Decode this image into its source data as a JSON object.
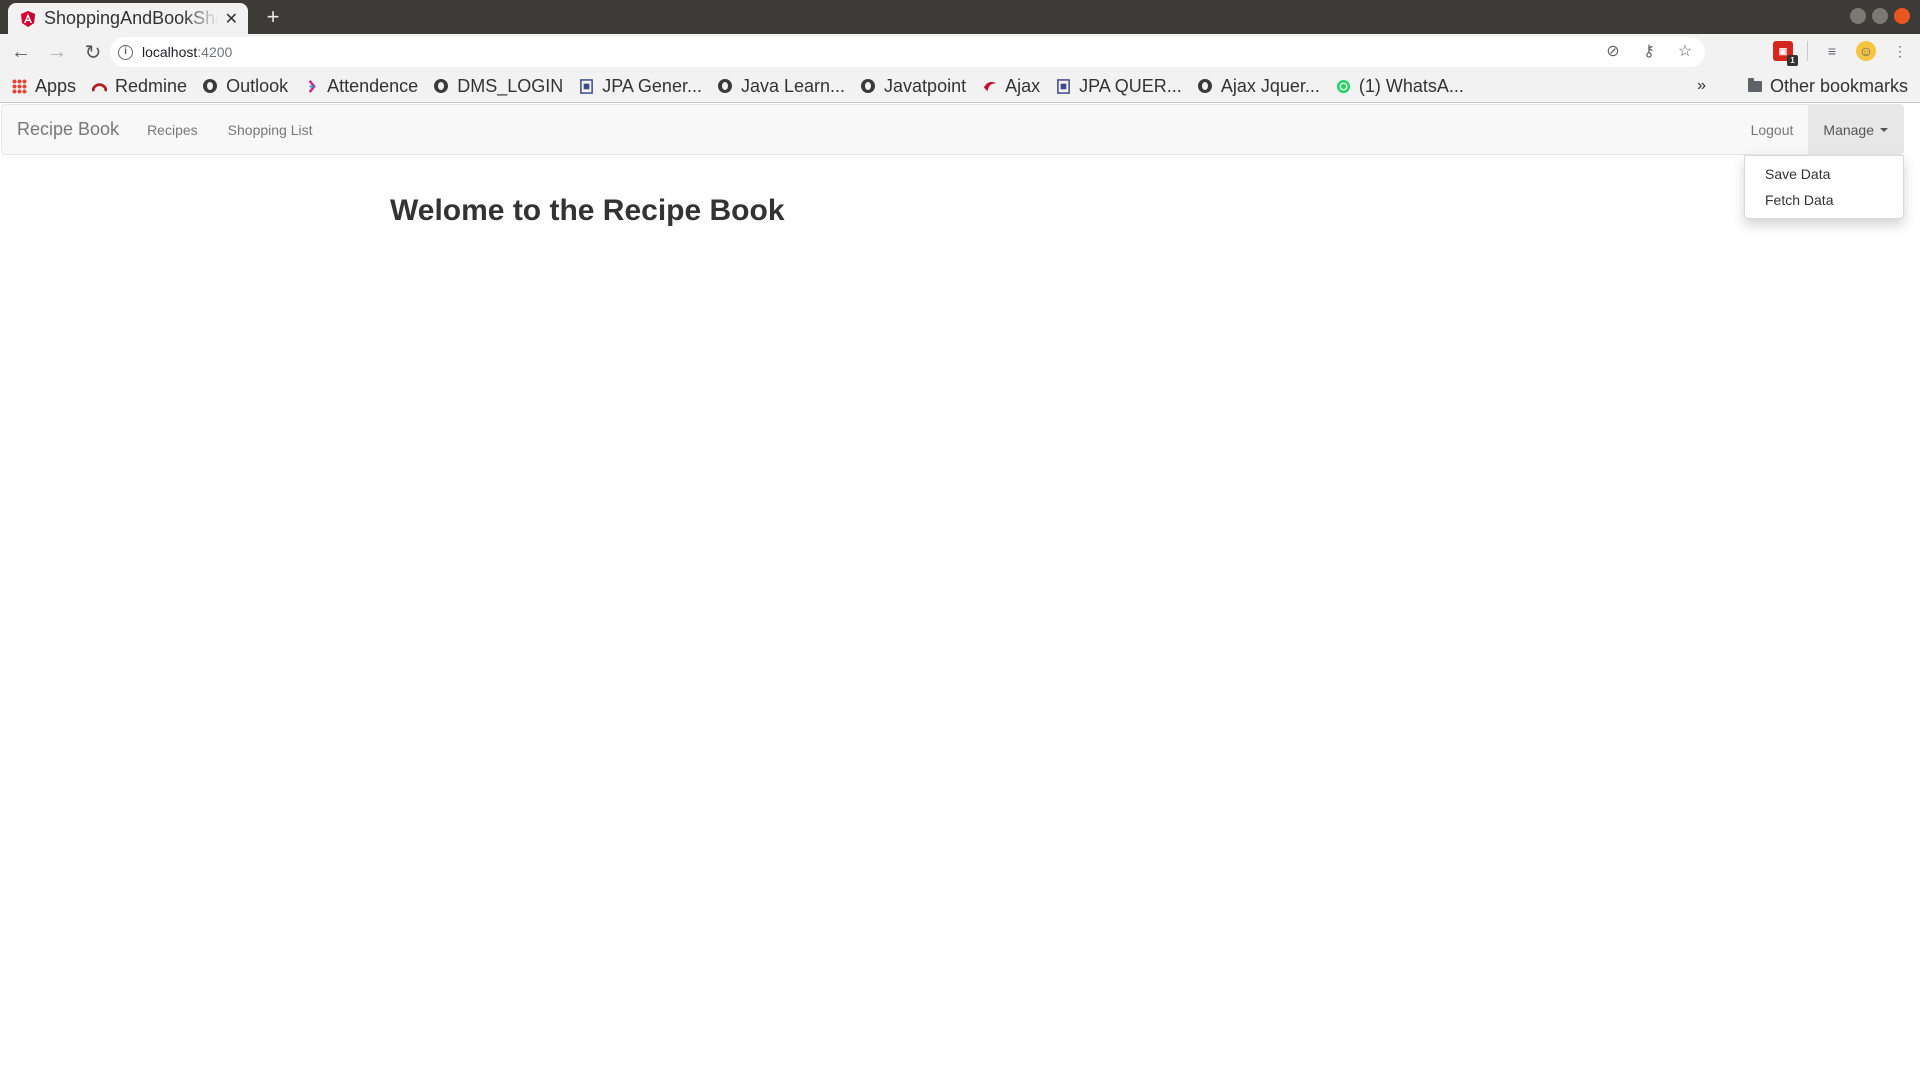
{
  "browser": {
    "tab_title": "ShoppingAndBookShop",
    "url_host": "localhost",
    "url_port": ":4200",
    "bookmarks": [
      {
        "label": "Apps",
        "icon": "apps-grid-icon"
      },
      {
        "label": "Redmine",
        "icon": "redmine-icon"
      },
      {
        "label": "Outlook",
        "icon": "globe-icon"
      },
      {
        "label": "Attendence",
        "icon": "attendence-icon"
      },
      {
        "label": "DMS_LOGIN",
        "icon": "globe-icon"
      },
      {
        "label": "JPA Gener...",
        "icon": "document-icon"
      },
      {
        "label": "Java Learn...",
        "icon": "globe-icon"
      },
      {
        "label": "Javatpoint",
        "icon": "globe-icon"
      },
      {
        "label": "Ajax",
        "icon": "ajax-icon"
      },
      {
        "label": "JPA QUER...",
        "icon": "document-icon"
      },
      {
        "label": "Ajax Jquer...",
        "icon": "globe-icon"
      },
      {
        "label": "(1) WhatsA...",
        "icon": "whatsapp-icon"
      }
    ],
    "more_bookmarks": "»",
    "other_bookmarks": "Other bookmarks"
  },
  "navbar": {
    "brand": "Recipe Book",
    "links": [
      "Recipes",
      "Shopping List"
    ],
    "logout": "Logout",
    "manage": "Manage"
  },
  "dropdown": {
    "items": [
      "Save Data",
      "Fetch Data"
    ]
  },
  "main": {
    "heading": "Welome to the Recipe Book"
  }
}
